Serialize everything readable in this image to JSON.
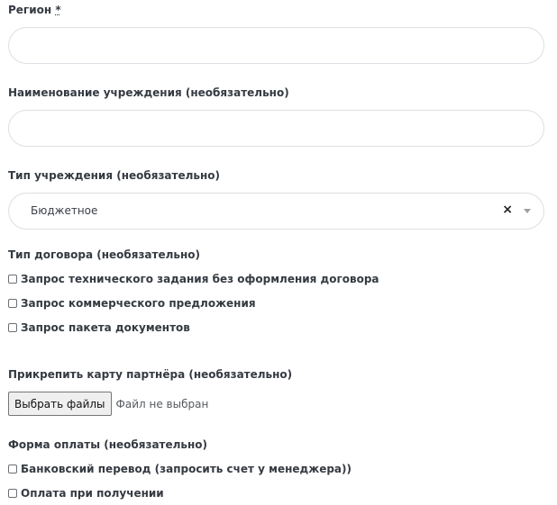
{
  "region": {
    "label": "Регион",
    "required_mark": "*"
  },
  "institution_name": {
    "label": "Наименование учреждения (необязательно)",
    "value": ""
  },
  "institution_type": {
    "label": "Тип учреждения (необязательно)",
    "selected": "Бюджетное",
    "clear_symbol": "×"
  },
  "contract_type": {
    "label": "Тип договора (необязательно)",
    "options": [
      {
        "label": "Запрос технического задания без оформления договора",
        "checked": false
      },
      {
        "label": "Запрос коммерческого предложения",
        "checked": false
      },
      {
        "label": "Запрос пакета документов",
        "checked": false
      }
    ]
  },
  "partner_card": {
    "label": "Прикрепить карту партнёра (необязательно)",
    "button_label": "Выбрать файлы",
    "status": "Файл не выбран"
  },
  "payment": {
    "label": "Форма оплаты (необязательно)",
    "options": [
      {
        "label": "Банковский перевод (запросить счет у менеджера))",
        "checked": false
      },
      {
        "label": "Оплата при получении",
        "checked": false
      }
    ]
  }
}
